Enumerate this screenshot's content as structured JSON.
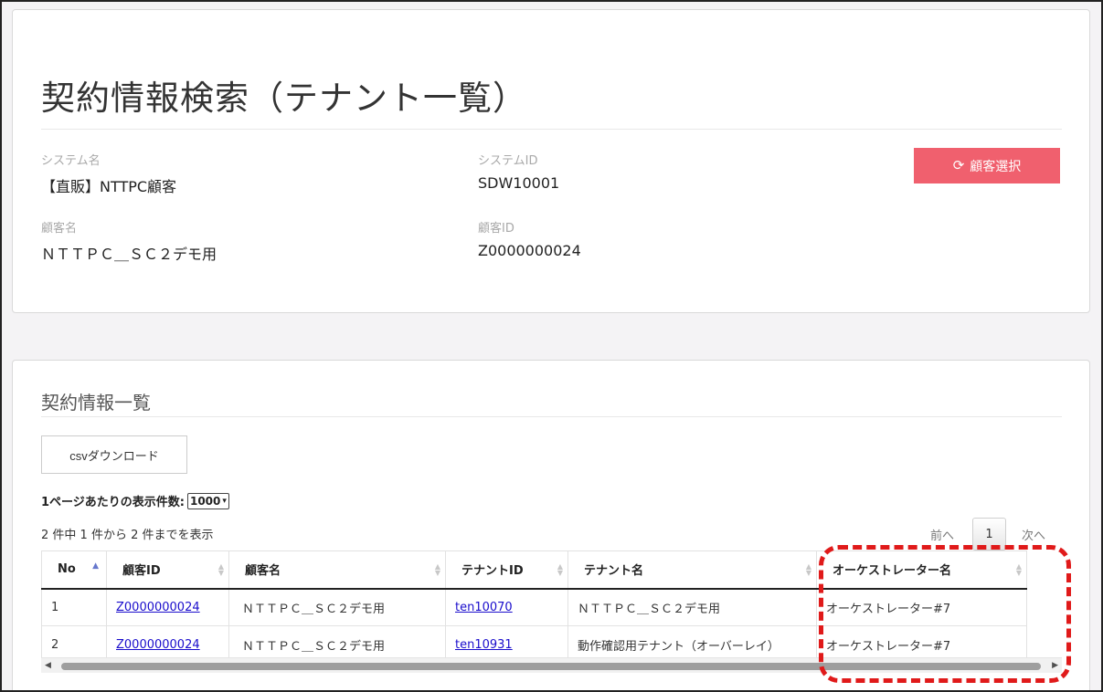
{
  "header": {
    "title": "契約情報検索（テナント一覧）",
    "system_name_label": "システム名",
    "system_name": "【直販】NTTPC顧客",
    "system_id_label": "システムID",
    "system_id": "SDW10001",
    "customer_name_label": "顧客名",
    "customer_name": "ＮＴＴＰＣ＿ＳＣ２デモ用",
    "customer_id_label": "顧客ID",
    "customer_id": "Z0000000024",
    "customer_select_button": "顧客選択",
    "customer_select_icon": "refresh-icon"
  },
  "list": {
    "title": "契約情報一覧",
    "csv_button": "csvダウンロード",
    "per_page_label": "1ページあたりの表示件数:",
    "per_page_value": "1000",
    "info": "2 件中 1 件から 2 件までを表示",
    "pagination": {
      "prev": "前へ",
      "current": "1",
      "next": "次へ"
    },
    "columns": [
      "No",
      "顧客ID",
      "顧客名",
      "テナントID",
      "テナント名",
      "オーケストレーター名"
    ],
    "rows": [
      {
        "no": "1",
        "customer_id": "Z0000000024",
        "customer_name": "ＮＴＴＰＣ＿ＳＣ２デモ用",
        "tenant_id": "ten10070",
        "tenant_name": "ＮＴＴＰＣ＿ＳＣ２デモ用",
        "orchestrator": "オーケストレーター#7"
      },
      {
        "no": "2",
        "customer_id": "Z0000000024",
        "customer_name": "ＮＴＴＰＣ＿ＳＣ２デモ用",
        "tenant_id": "ten10931",
        "tenant_name": "動作確認用テナント（オーバーレイ）",
        "orchestrator": "オーケストレーター#7"
      }
    ]
  },
  "colors": {
    "accent_button": "#f0606e",
    "link": "#1a0dcc",
    "highlight": "#e01a1a"
  }
}
